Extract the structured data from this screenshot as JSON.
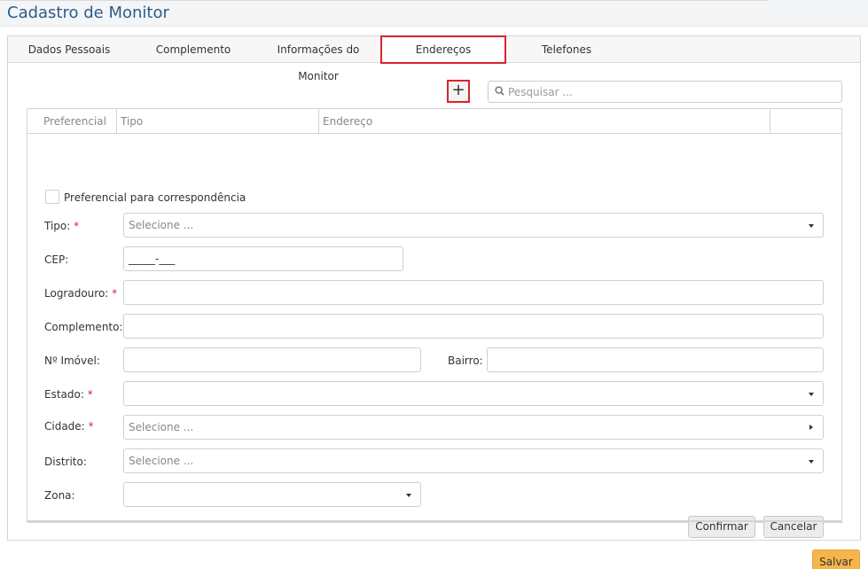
{
  "page": {
    "title": "Cadastro de Monitor"
  },
  "tabs": [
    {
      "label": "Dados Pessoais"
    },
    {
      "label": "Complemento"
    },
    {
      "label": "Informações do Monitor"
    },
    {
      "label": "Endereços"
    },
    {
      "label": "Telefones"
    }
  ],
  "toolbar": {
    "add_label": "+",
    "search_placeholder": "Pesquisar ..."
  },
  "grid": {
    "columns": [
      "Preferencial",
      "Tipo",
      "Endereço",
      ""
    ]
  },
  "form": {
    "preferencial_label": "Preferencial para correspondência",
    "required_mark": "*",
    "tipo": {
      "label": "Tipo:",
      "placeholder": "Selecione ..."
    },
    "cep": {
      "label": "CEP:",
      "value": "_____-___"
    },
    "logradouro": {
      "label": "Logradouro:"
    },
    "complemento": {
      "label": "Complemento:"
    },
    "numero": {
      "label": "Nº Imóvel:"
    },
    "bairro": {
      "label": "Bairro:"
    },
    "estado": {
      "label": "Estado:"
    },
    "cidade": {
      "label": "Cidade:",
      "placeholder": "Selecione ..."
    },
    "distrito": {
      "label": "Distrito:",
      "placeholder": "Selecione ..."
    },
    "zona": {
      "label": "Zona:"
    },
    "confirm_label": "Confirmar",
    "cancel_label": "Cancelar"
  },
  "footer": {
    "save_label": "Salvar"
  },
  "colors": {
    "accent": "#d9232e",
    "title": "#2b5d8a",
    "save": "#f5b54a"
  }
}
